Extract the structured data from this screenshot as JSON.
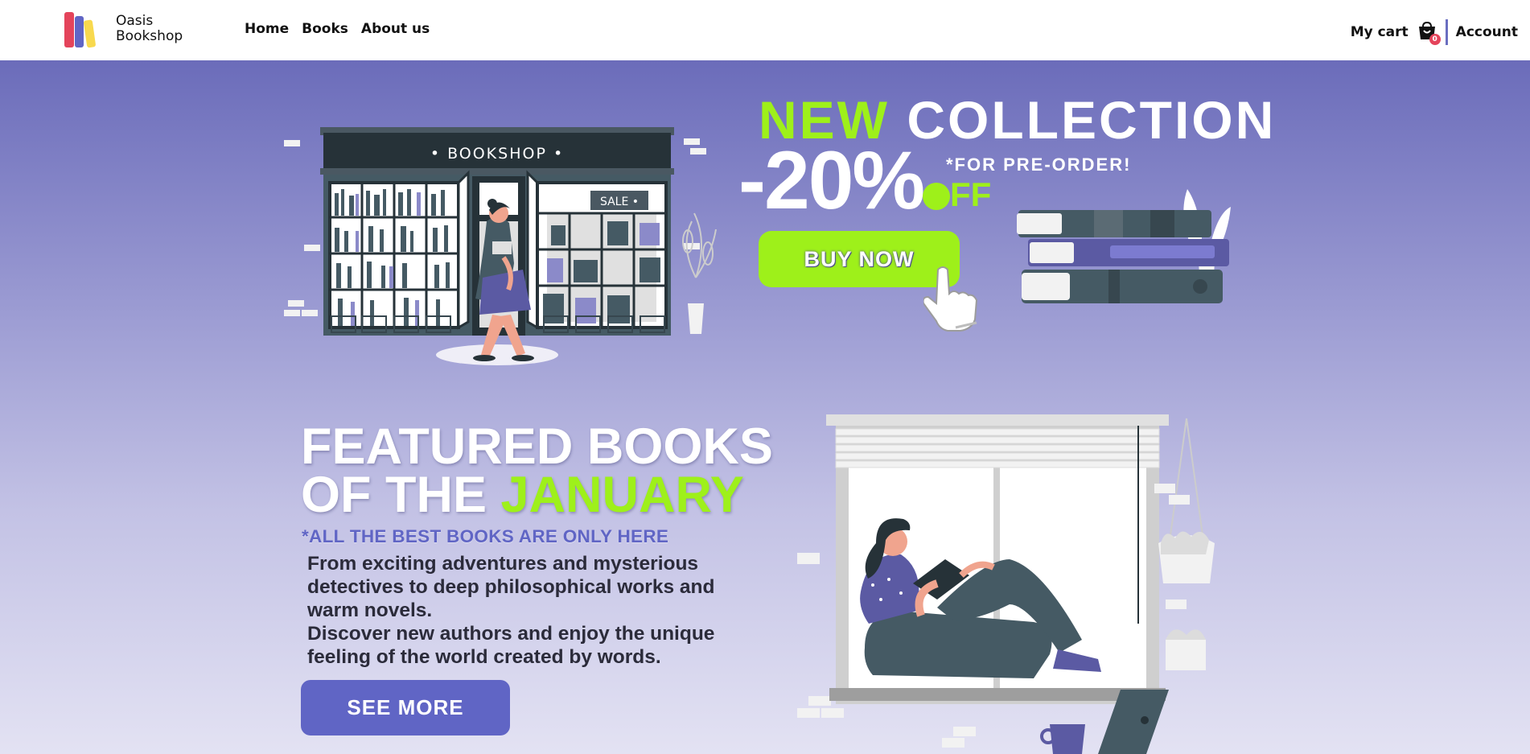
{
  "header": {
    "brand_line1": "Oasis",
    "brand_line2": "Bookshop",
    "nav": [
      "Home",
      "Books",
      "About us"
    ],
    "cart_label": "My cart",
    "cart_count": "0",
    "account_label": "Account"
  },
  "promo": {
    "title_highlight": "NEW",
    "title_rest": "COLLECTION",
    "discount": "-20%",
    "note": "*FOR PRE-ORDER!",
    "off": "FF",
    "buy_label": "BUY NOW",
    "sign_text": "• BOOKSHOP •",
    "sale_tag": "SALE •"
  },
  "featured": {
    "title_line1": "FEATURED BOOKS",
    "title_line2_prefix": "OF THE",
    "title_line2_highlight": "JANUARY",
    "subtitle": "*ALL THE BEST BOOKS ARE ONLY HERE",
    "desc_line1": "From exciting adventures and mysterious",
    "desc_line2": "detectives to deep philosophical works and",
    "desc_line3": "warm novels.",
    "desc_line4": "Discover new authors and enjoy the unique",
    "desc_line5": "feeling of the world created by words.",
    "button_label": "SEE MORE"
  },
  "colors": {
    "accent_lime": "#9ef01a",
    "accent_purple": "#6065c5",
    "hero_top": "#6b6cba",
    "badge_red": "#e4445b"
  }
}
